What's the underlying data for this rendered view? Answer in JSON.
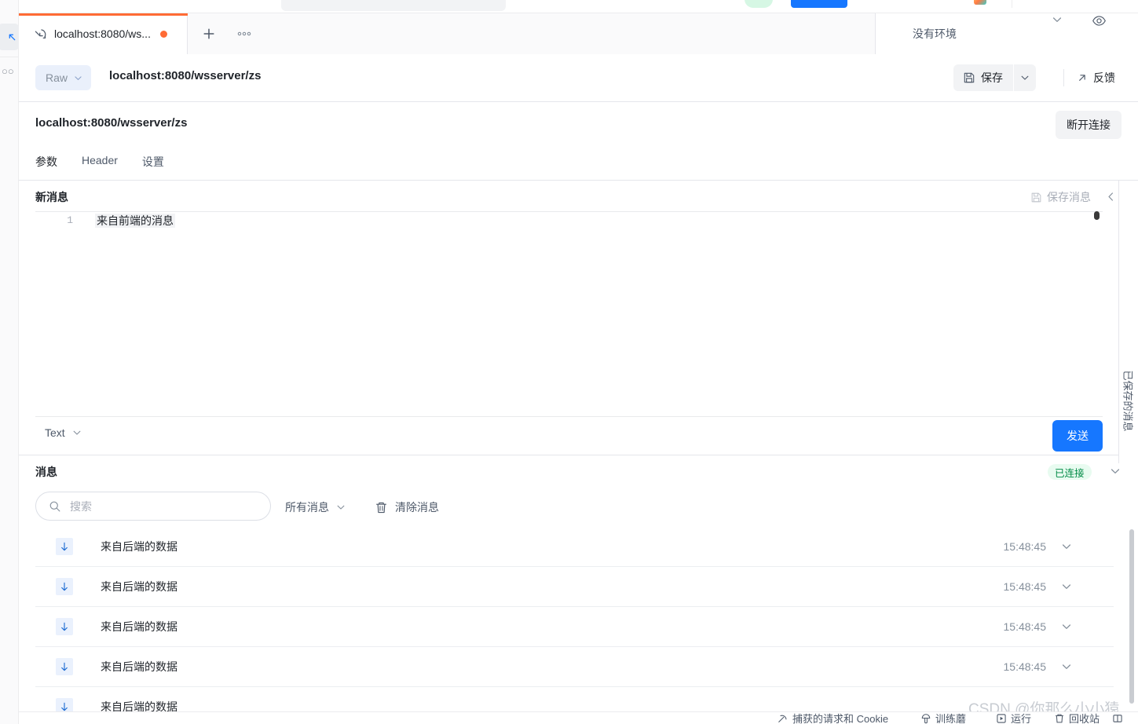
{
  "app": {
    "tab": {
      "label": "localhost:8080/ws...",
      "icon": "websocket-icon",
      "dirty_dot": true
    },
    "new_tab_label": "+",
    "more_tabs_label": "●●●",
    "environment": {
      "label": "没有环境",
      "caret": "⌄",
      "eye_icon": "eye-icon"
    }
  },
  "urlbar": {
    "method_label": "Raw",
    "method_caret": "⌄",
    "url": "localhost:8080/wsserver/zs",
    "save_label": "保存",
    "save_caret": "⌄",
    "feedback_label": "反馈",
    "feedback_icon": "external-link-icon"
  },
  "request": {
    "title": "localhost:8080/wsserver/zs",
    "disconnect_label": "断开连接",
    "tabs": [
      {
        "label": "参数",
        "active": true
      },
      {
        "label": "Header",
        "active": false
      },
      {
        "label": "设置",
        "active": false
      }
    ]
  },
  "new_message": {
    "title": "新消息",
    "save_message_label": "保存消息",
    "collapse_icon": "chevron-left-icon",
    "editor": {
      "line_number": "1",
      "content": "来自前端的消息"
    },
    "type_label": "Text",
    "type_caret": "⌄",
    "send_label": "发送"
  },
  "saved_rail": {
    "label": "已保存的消息"
  },
  "messages": {
    "title": "消息",
    "connection_status": "已连接",
    "status_caret": "⌄",
    "search_placeholder": "搜索",
    "search_value": "",
    "filter_label": "所有消息",
    "filter_caret": "⌄",
    "clear_label": "清除消息",
    "clear_icon": "trash-icon",
    "rows": [
      {
        "direction": "down",
        "text": "来自后端的数据",
        "time": "15:48:45"
      },
      {
        "direction": "down",
        "text": "来自后端的数据",
        "time": "15:48:45"
      },
      {
        "direction": "down",
        "text": "来自后端的数据",
        "time": "15:48:45"
      },
      {
        "direction": "down",
        "text": "来自后端的数据",
        "time": "15:48:45"
      },
      {
        "direction": "down",
        "text": "来自后端的数据",
        "time": ""
      }
    ]
  },
  "statusbar": {
    "items": [
      {
        "label": "捕获的请求和 Cookie",
        "icon": "antenna-icon"
      },
      {
        "label": "训练蘑",
        "icon": "mushroom-icon"
      },
      {
        "label": "运行",
        "icon": "run-icon"
      },
      {
        "label": "回收站",
        "icon": "trash-icon"
      },
      {
        "label": "",
        "icon": "layout-icon"
      },
      {
        "label": "",
        "icon": "help-icon"
      }
    ]
  },
  "watermark": {
    "text": "CSDN @你那么小小猿"
  },
  "colors": {
    "accent_orange": "#ff6b35",
    "primary_blue": "#1677ff",
    "connected_green": "#008a45"
  }
}
